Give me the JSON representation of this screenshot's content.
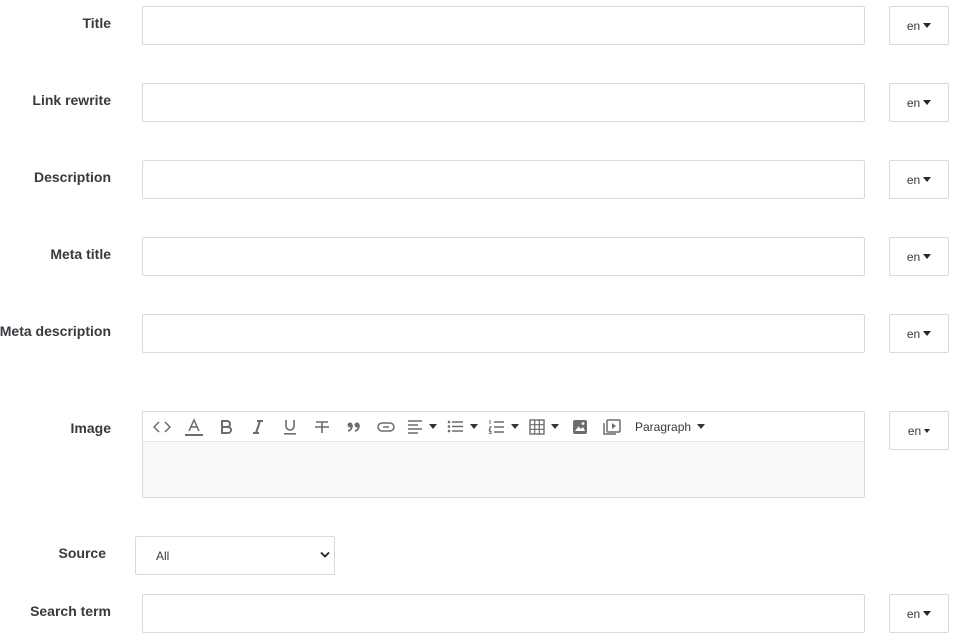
{
  "fields": {
    "title": {
      "label": "Title",
      "lang": "en"
    },
    "link_rewrite": {
      "label": "Link rewrite",
      "lang": "en"
    },
    "description": {
      "label": "Description",
      "lang": "en"
    },
    "meta_title": {
      "label": "Meta title",
      "lang": "en"
    },
    "meta_description": {
      "label": "Meta description",
      "lang": "en"
    },
    "image": {
      "label": "Image",
      "lang": "en"
    },
    "source": {
      "label": "Source",
      "selected": "All"
    },
    "search_term": {
      "label": "Search term",
      "lang": "en"
    }
  },
  "editor": {
    "paragraph_label": "Paragraph",
    "toolbar_icons": [
      "code-icon",
      "text-color-icon",
      "bold-icon",
      "italic-icon",
      "underline-icon",
      "strikethrough-icon",
      "blockquote-icon",
      "link-icon",
      "align-icon",
      "bullet-list-icon",
      "numbered-list-icon",
      "table-icon",
      "image-icon",
      "media-icon"
    ]
  },
  "colors": {
    "border": "#d9d9d9",
    "text": "#363a41",
    "editor_bg": "#f8f9fb"
  }
}
